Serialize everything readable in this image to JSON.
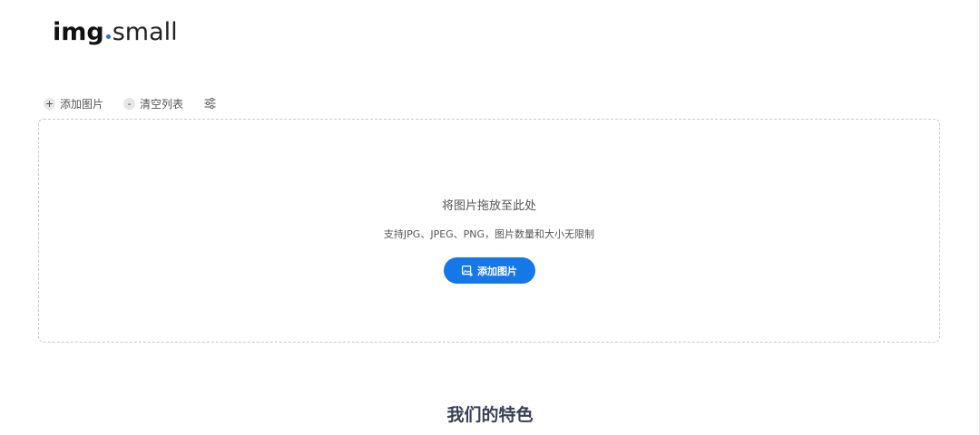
{
  "logo": {
    "bold": "img",
    "light": "small",
    "dot_color": "#1677e8"
  },
  "toolbar": {
    "add": {
      "icon": "plus-icon",
      "symbol": "+",
      "label": "添加图片"
    },
    "clear": {
      "icon": "minus-icon",
      "symbol": "-",
      "label": "清空列表"
    },
    "settings": {
      "icon": "sliders-icon"
    }
  },
  "dropzone": {
    "title": "将图片拖放至此处",
    "subtitle": "支持JPG、JPEG、PNG，图片数量和大小无限制",
    "button": {
      "icon": "image-add-icon",
      "label": "添加图片",
      "color": "#1677e8"
    }
  },
  "features": {
    "heading": "我们的特色"
  }
}
